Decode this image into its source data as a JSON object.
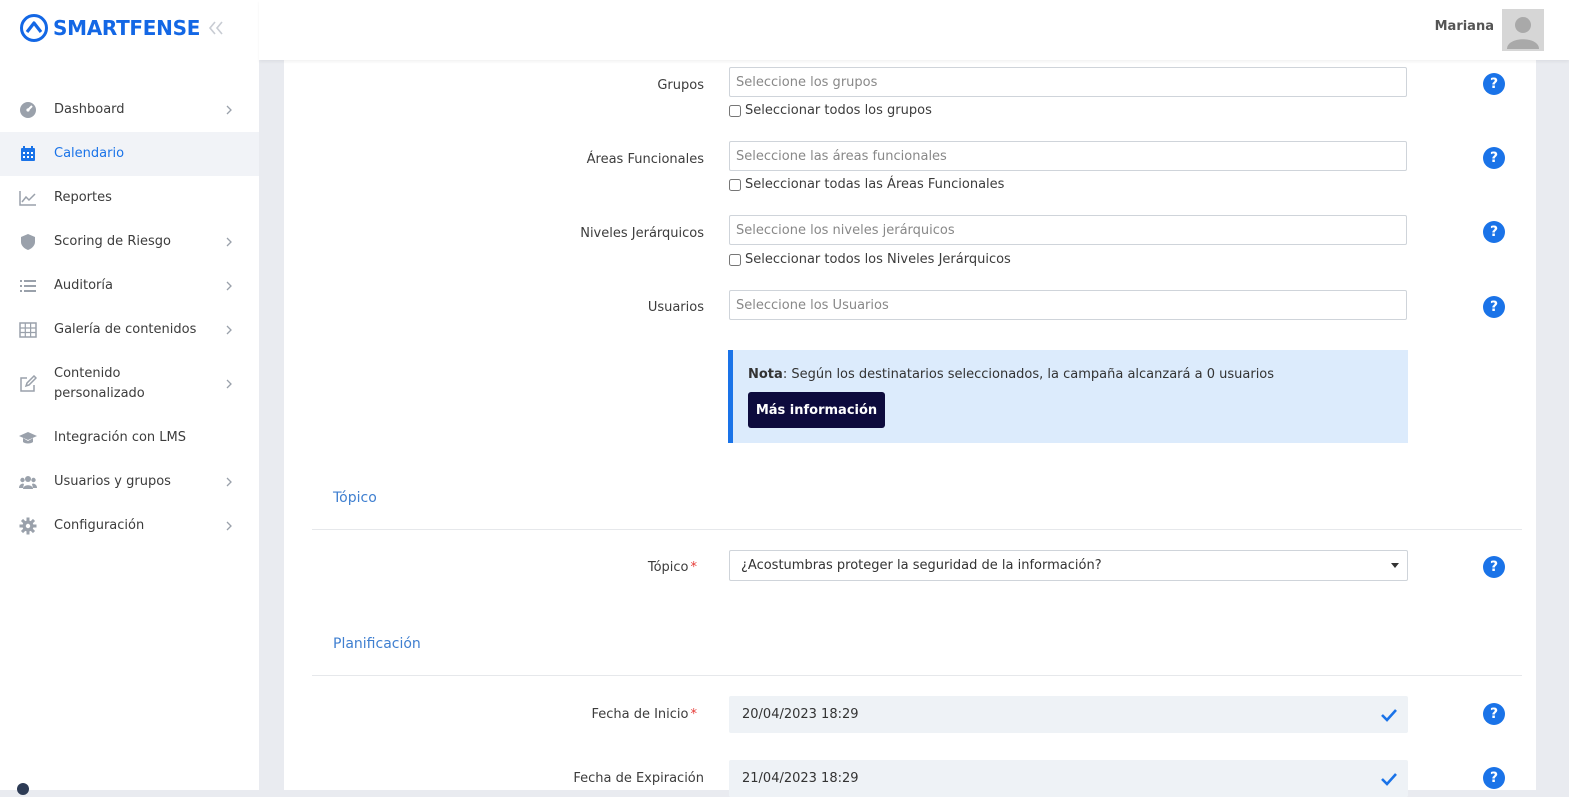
{
  "brand": {
    "name": "SMARTFENSE"
  },
  "header": {
    "user_name": "Mariana"
  },
  "sidebar": {
    "items": [
      {
        "label": "Dashboard",
        "icon": "gauge-icon",
        "chevron": true
      },
      {
        "label": "Calendario",
        "icon": "calendar-icon",
        "chevron": false,
        "active": true
      },
      {
        "label": "Reportes",
        "icon": "line-chart-icon",
        "chevron": false
      },
      {
        "label": "Scoring de Riesgo",
        "icon": "shield-icon",
        "chevron": true
      },
      {
        "label": "Auditoría",
        "icon": "list-icon",
        "chevron": true
      },
      {
        "label": "Galería de contenidos",
        "icon": "grid-icon",
        "chevron": true
      },
      {
        "label": "Contenido personalizado",
        "icon": "edit-icon",
        "chevron": true
      },
      {
        "label": "Integración con LMS",
        "icon": "graduation-cap-icon",
        "chevron": false
      },
      {
        "label": "Usuarios y grupos",
        "icon": "users-icon",
        "chevron": true
      },
      {
        "label": "Configuración",
        "icon": "gear-icon",
        "chevron": true
      }
    ]
  },
  "form": {
    "grupos": {
      "label": "Grupos",
      "placeholder": "Seleccione los grupos",
      "check_label": "Seleccionar todos los grupos"
    },
    "areas": {
      "label": "Áreas Funcionales",
      "placeholder": "Seleccione las áreas funcionales",
      "check_label": "Seleccionar todas las Áreas Funcionales"
    },
    "niveles": {
      "label": "Niveles Jerárquicos",
      "placeholder": "Seleccione los niveles jerárquicos",
      "check_label": "Seleccionar todos los Niveles Jerárquicos"
    },
    "usuarios": {
      "label": "Usuarios",
      "placeholder": "Seleccione los Usuarios"
    },
    "note": {
      "bold": "Nota",
      "text": ": Según los destinatarios seleccionados, la campaña alcanzará a 0 usuarios",
      "button": "Más información"
    },
    "topico_section": {
      "title": "Tópico"
    },
    "topico": {
      "label": "Tópico",
      "required_mark": "*",
      "value": "¿Acostumbras proteger la seguridad de la información?"
    },
    "planificacion_section": {
      "title": "Planificación"
    },
    "fecha_inicio": {
      "label": "Fecha de Inicio",
      "required_mark": "*",
      "value": "20/04/2023 18:29"
    },
    "fecha_expiracion": {
      "label": "Fecha de Expiración",
      "value": "21/04/2023 18:29"
    },
    "help_symbol": "?"
  },
  "colors": {
    "accent": "#1a73e8",
    "brand": "#1367e5",
    "note_bg": "#dcebfc",
    "note_button": "#0d0b3d",
    "section_title": "#3f7fd0"
  }
}
